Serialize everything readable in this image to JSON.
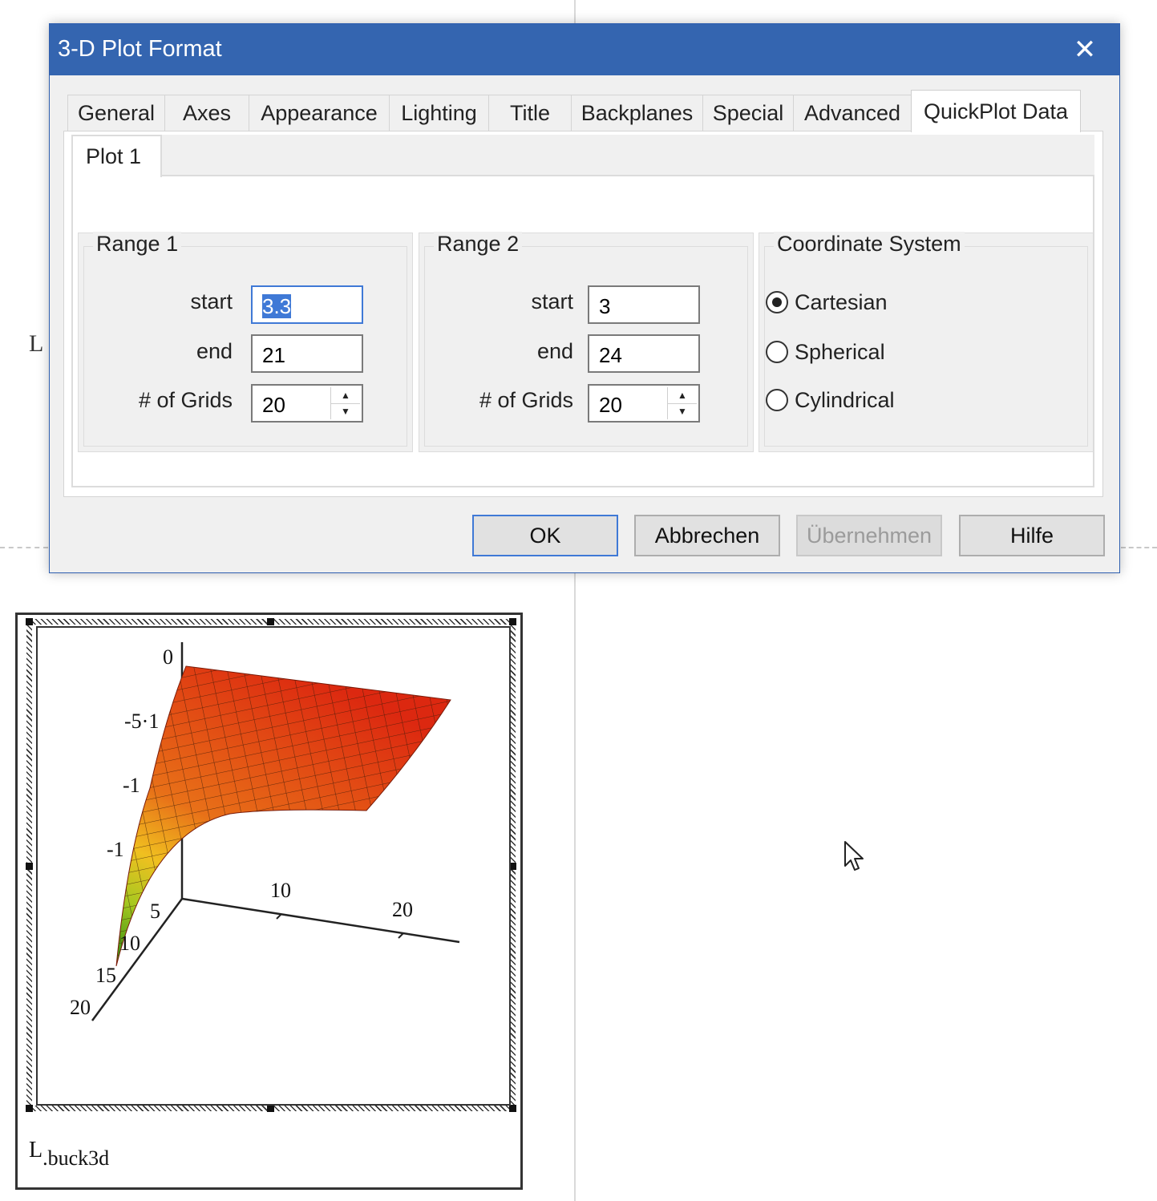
{
  "background": {
    "left_label": "L"
  },
  "dialog": {
    "title": "3-D Plot Format",
    "close_glyph": "✕",
    "tabs": [
      {
        "label": "General",
        "active": false
      },
      {
        "label": "Axes",
        "active": false
      },
      {
        "label": "Appearance",
        "active": false
      },
      {
        "label": "Lighting",
        "active": false
      },
      {
        "label": "Title",
        "active": false
      },
      {
        "label": "Backplanes",
        "active": false
      },
      {
        "label": "Special",
        "active": false
      },
      {
        "label": "Advanced",
        "active": false
      },
      {
        "label": "QuickPlot Data",
        "active": true
      }
    ],
    "inner_tab": "Plot 1",
    "range1": {
      "legend": "Range 1",
      "start_label": "start",
      "start_value": "3.3",
      "end_label": "end",
      "end_value": "21",
      "grids_label": "# of Grids",
      "grids_value": "20"
    },
    "range2": {
      "legend": "Range 2",
      "start_label": "start",
      "start_value": "3",
      "end_label": "end",
      "end_value": "24",
      "grids_label": "# of Grids",
      "grids_value": "20"
    },
    "coordinate": {
      "legend": "Coordinate System",
      "options": [
        "Cartesian",
        "Spherical",
        "Cylindrical"
      ],
      "selected": "Cartesian"
    },
    "buttons": {
      "ok": "OK",
      "cancel": "Abbrechen",
      "apply": "Übernehmen",
      "help": "Hilfe"
    }
  },
  "plot": {
    "caption_main": "L",
    "caption_sub": ".buck3d",
    "z_ticks": [
      "0",
      "-5·1",
      "-1",
      "-1"
    ],
    "y_ticks": [
      "5",
      "10",
      "15",
      "20"
    ],
    "x_ticks": [
      "10",
      "20"
    ],
    "colors": {
      "high": "#e02010",
      "mid": "#e8a020",
      "low": "#2a8a10"
    }
  }
}
